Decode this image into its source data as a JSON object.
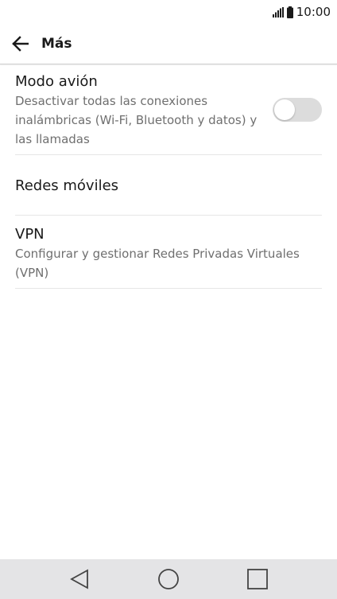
{
  "status_bar": {
    "time": "10:00",
    "icons": [
      "signal-icon",
      "battery-icon"
    ]
  },
  "header": {
    "back_icon": "arrow-left-icon",
    "title": "Más"
  },
  "settings": [
    {
      "title": "Modo avión",
      "summary": "Desactivar todas las conexiones inalámbricas (Wi-Fi, Bluetooth y datos) y las llamadas",
      "toggle": "off"
    },
    {
      "title": "Redes móviles"
    },
    {
      "title": "VPN",
      "summary": "Configurar y gestionar Redes Privadas Virtuales (VPN)"
    }
  ],
  "nav_bar": {
    "icons": [
      "nav-back-icon",
      "nav-home-icon",
      "nav-recents-icon"
    ]
  },
  "colors": {
    "background": "#ffffff",
    "primary_text": "#1a1a1a",
    "secondary_text": "#6f6f6f",
    "divider": "#e6e6e6",
    "toggle_track_off": "#dcdcdc",
    "nav_bar_background": "#e4e4e6"
  }
}
